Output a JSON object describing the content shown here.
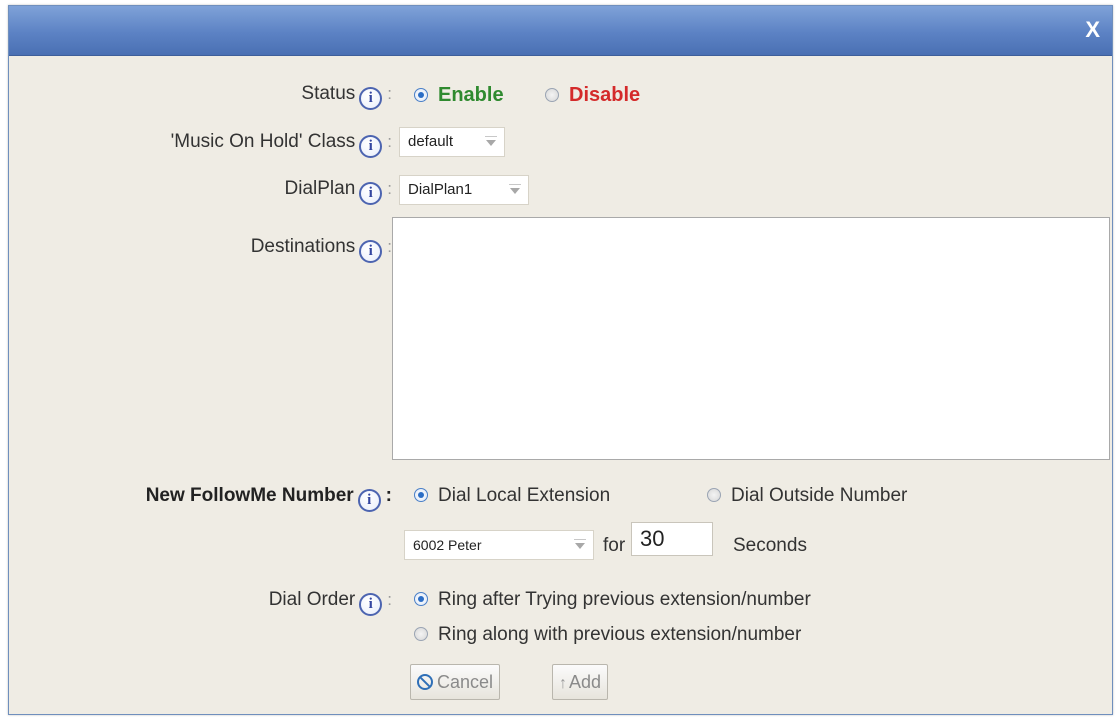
{
  "dialog": {
    "close_label": "X"
  },
  "status": {
    "label": "Status",
    "options": [
      {
        "label": "Enable",
        "selected": true,
        "color": "#2f8a2f"
      },
      {
        "label": "Disable",
        "selected": false,
        "color": "#d42a2a"
      }
    ]
  },
  "moh": {
    "label": "'Music On Hold' Class",
    "value": "default"
  },
  "dialplan": {
    "label": "DialPlan",
    "value": "DialPlan1"
  },
  "destinations": {
    "label": "Destinations"
  },
  "followme": {
    "label": "New FollowMe Number",
    "options": [
      {
        "label": "Dial Local Extension",
        "selected": true
      },
      {
        "label": "Dial Outside Number",
        "selected": false
      }
    ],
    "extension_value": "6002 Peter",
    "for_label": "for",
    "seconds_value": "30",
    "seconds_label": "Seconds"
  },
  "dial_order": {
    "label": "Dial Order",
    "options": [
      {
        "label": "Ring after Trying previous extension/number",
        "selected": true
      },
      {
        "label": "Ring along with previous extension/number",
        "selected": false
      }
    ]
  },
  "buttons": {
    "cancel_label": "Cancel",
    "add_label": "Add"
  },
  "icons": {
    "info": "info-icon",
    "close": "close-icon",
    "cancel": "cancel-icon",
    "add": "up-arrow-icon"
  }
}
